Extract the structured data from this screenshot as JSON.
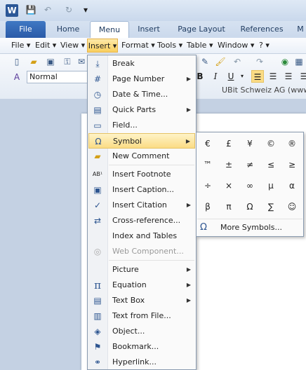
{
  "quick_access": {
    "logo": "W"
  },
  "ribbon_tabs": [
    {
      "id": "file",
      "label": "File"
    },
    {
      "id": "home",
      "label": "Home"
    },
    {
      "id": "menu",
      "label": "Menu"
    },
    {
      "id": "insert",
      "label": "Insert"
    },
    {
      "id": "page_layout",
      "label": "Page Layout"
    },
    {
      "id": "references",
      "label": "References"
    },
    {
      "id": "more",
      "label": "M"
    }
  ],
  "menubar": [
    "File ▾",
    "Edit ▾",
    "View ▾",
    "Insert ▾",
    "Format ▾",
    "Tools ▾",
    "Table ▾",
    "Window ▾",
    "? ▾"
  ],
  "toolbar": {
    "style_value": "Normal",
    "company": "UBit Schweiz AG (www."
  },
  "insert_menu": [
    {
      "label": "Break",
      "icon": "break-icon",
      "submenu": false
    },
    {
      "label": "Page Number",
      "icon": "page-number-icon",
      "submenu": true
    },
    {
      "label": "Date & Time...",
      "icon": "date-time-icon",
      "submenu": false
    },
    {
      "label": "Quick Parts",
      "icon": "quick-parts-icon",
      "submenu": true
    },
    {
      "label": "Field...",
      "icon": "field-icon",
      "submenu": false
    },
    {
      "label": "Symbol",
      "icon": "omega-icon",
      "submenu": true,
      "highlighted": true
    },
    {
      "label": "New Comment",
      "icon": "comment-icon",
      "submenu": false
    },
    {
      "label": "Insert Footnote",
      "icon": "footnote-icon",
      "submenu": false
    },
    {
      "label": "Insert Caption...",
      "icon": "caption-icon",
      "submenu": false
    },
    {
      "label": "Insert Citation",
      "icon": "citation-icon",
      "submenu": true
    },
    {
      "label": "Cross-reference...",
      "icon": "cross-reference-icon",
      "submenu": false
    },
    {
      "label": "Index and Tables",
      "icon": "",
      "submenu": false
    },
    {
      "label": "Web Component...",
      "icon": "web-component-icon",
      "submenu": false,
      "disabled": true
    },
    {
      "label": "Picture",
      "icon": "",
      "submenu": true
    },
    {
      "label": "Equation",
      "icon": "pi-icon",
      "submenu": true
    },
    {
      "label": "Text Box",
      "icon": "text-box-icon",
      "submenu": true
    },
    {
      "label": "Text from File...",
      "icon": "text-file-icon",
      "submenu": false
    },
    {
      "label": "Object...",
      "icon": "object-icon",
      "submenu": false
    },
    {
      "label": "Bookmark...",
      "icon": "bookmark-icon",
      "submenu": false
    },
    {
      "label": "Hyperlink...",
      "icon": "hyperlink-icon",
      "submenu": false
    }
  ],
  "symbol_menu": {
    "symbols": [
      "€",
      "£",
      "¥",
      "©",
      "®",
      "™",
      "±",
      "≠",
      "≤",
      "≥",
      "÷",
      "×",
      "∞",
      "µ",
      "α",
      "β",
      "π",
      "Ω",
      "∑",
      "☺"
    ],
    "more_label": "More Symbols..."
  },
  "colors": {
    "accent": "#2b5797",
    "highlight": "#fbdc85"
  }
}
